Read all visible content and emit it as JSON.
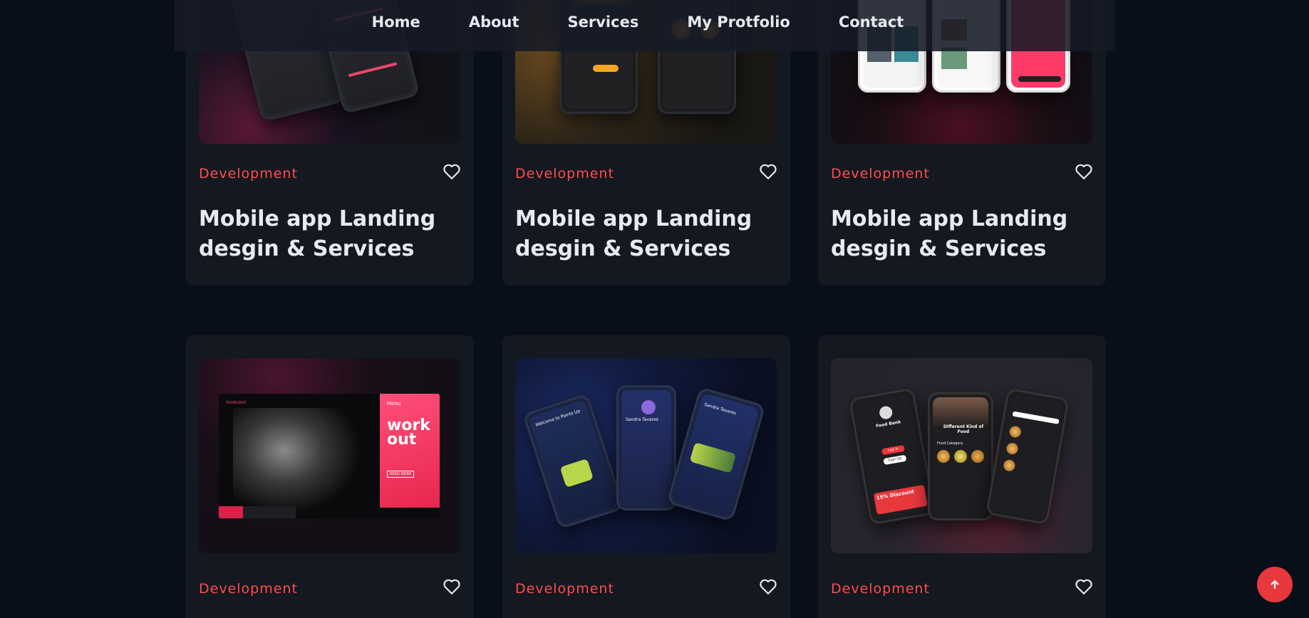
{
  "nav": {
    "items": [
      "Home",
      "About",
      "Services",
      "My Protfolio",
      "Contact"
    ]
  },
  "cards_row1": [
    {
      "category": "Development",
      "title_line1": "Mobile app Landing",
      "title_line2": "desgin & Services",
      "art": "purple-phones-dark"
    },
    {
      "category": "Development",
      "title_line1": "Mobile app Landing",
      "title_line2": "desgin & Services",
      "art": "burger-app-phones"
    },
    {
      "category": "Development",
      "title_line1": "Mobile app Landing",
      "title_line2": "desgin & Services",
      "art": "travel-app-pink-phones"
    }
  ],
  "cards_row2": [
    {
      "category": "Development",
      "art": "workout-landing-page",
      "mock_text": {
        "logo": "YOURLOGO",
        "menu": "Menu",
        "headline1": "work",
        "headline2": "out",
        "button": "READ MORE"
      }
    },
    {
      "category": "Development",
      "art": "points-app-blue-phones",
      "mock_text": {
        "welcome": "Welcome to Points Up",
        "user1": "Sandra Tavares",
        "user2": "Sandra Tavares"
      }
    },
    {
      "category": "Development",
      "art": "food-bank-phones",
      "mock_text": {
        "app_name": "Food Bank",
        "login": "Log in",
        "signup": "Sign Up",
        "promo": "15% Discount",
        "headline": "Different Kind of Food",
        "section": "Food Category"
      }
    }
  ],
  "colors": {
    "background": "#080e1a",
    "card": "#141820",
    "accent": "#ff4e4e",
    "scroll_button": "#e8383d"
  },
  "icons": {
    "like": "heart-outline-icon",
    "scroll_top": "arrow-up-icon"
  }
}
